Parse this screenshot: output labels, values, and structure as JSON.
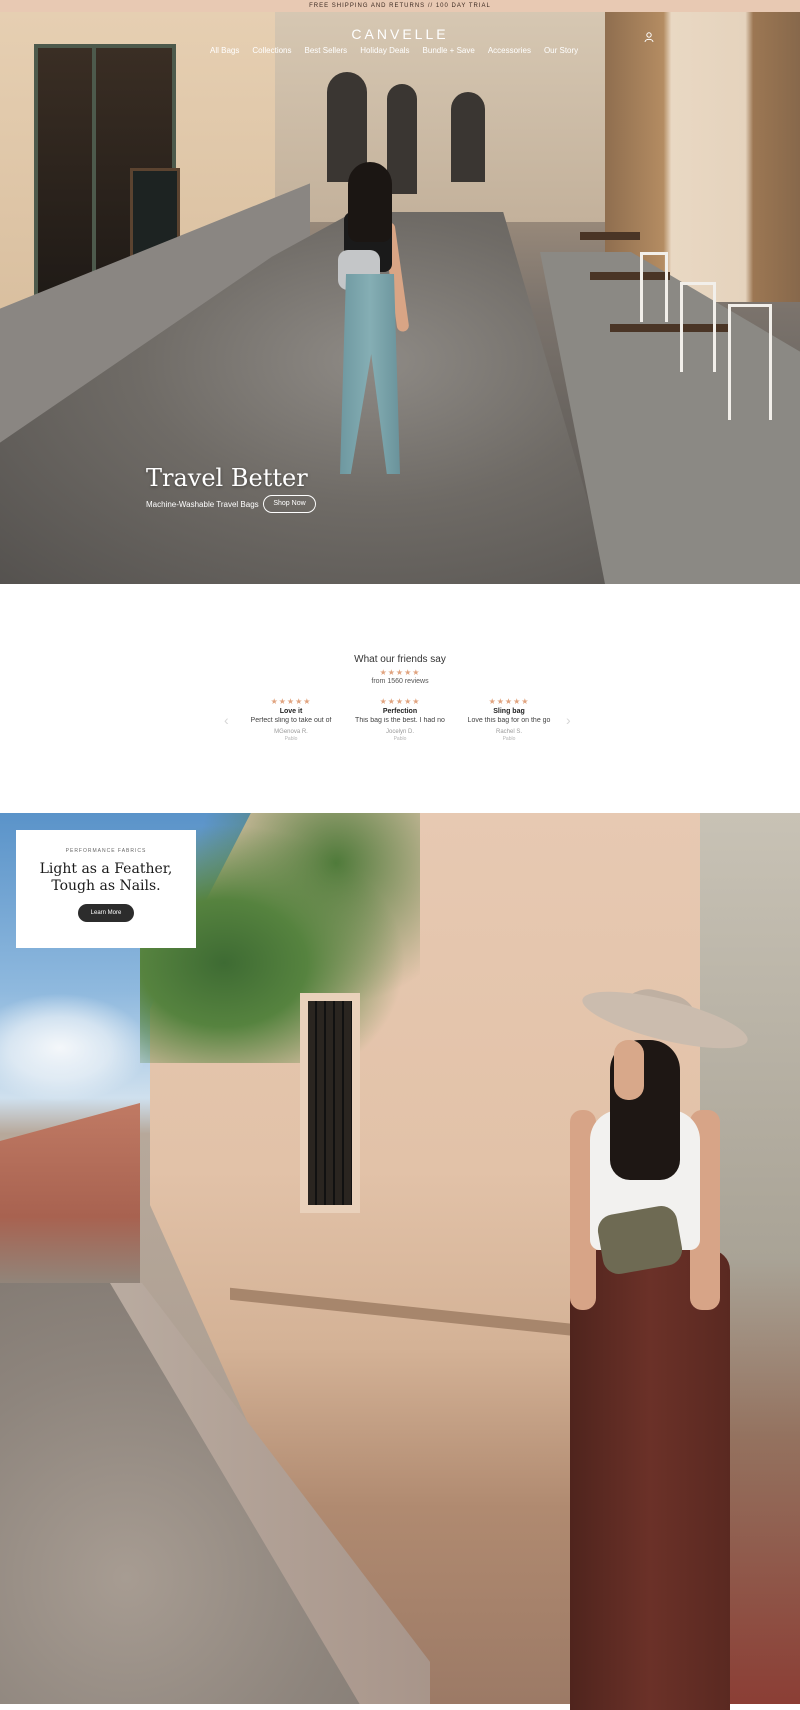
{
  "announcement": "FREE SHIPPING AND RETURNS // 100 DAY TRIAL",
  "header": {
    "logo": "CANVELLE",
    "nav": [
      "All Bags",
      "Collections",
      "Best Sellers",
      "Holiday Deals",
      "Bundle + Save",
      "Accessories",
      "Our Story"
    ],
    "account_icon": "user-icon"
  },
  "hero": {
    "title": "Travel Better",
    "subtitle": "Machine-Washable Travel Bags",
    "cta": "Shop Now"
  },
  "reviews": {
    "title": "What our friends say",
    "rating_stars": "★★★★★",
    "count": "from 1560 reviews",
    "prev_icon": "chevron-left-icon",
    "next_icon": "chevron-right-icon",
    "items": [
      {
        "stars": "★★★★★",
        "title": "Love it",
        "text": "Perfect sling to take out of",
        "author": "MGenova R.",
        "product": "Pablo"
      },
      {
        "stars": "★★★★★",
        "title": "Perfection",
        "text": "This bag is the best. I had no",
        "author": "Jocelyn D.",
        "product": "Pablo"
      },
      {
        "stars": "★★★★★",
        "title": "Sling bag",
        "text": "Love this bag for on the go",
        "author": "Rachel S.",
        "product": "Pablo"
      }
    ]
  },
  "promo": {
    "eyebrow": "PERFORMANCE FABRICS",
    "title_line1": "Light as a Feather,",
    "title_line2": "Tough as Nails.",
    "cta": "Learn More"
  },
  "colors": {
    "announcement_bg": "#e8c9b3",
    "star": "#e0a37f",
    "button_dark": "#2c2c2c"
  }
}
